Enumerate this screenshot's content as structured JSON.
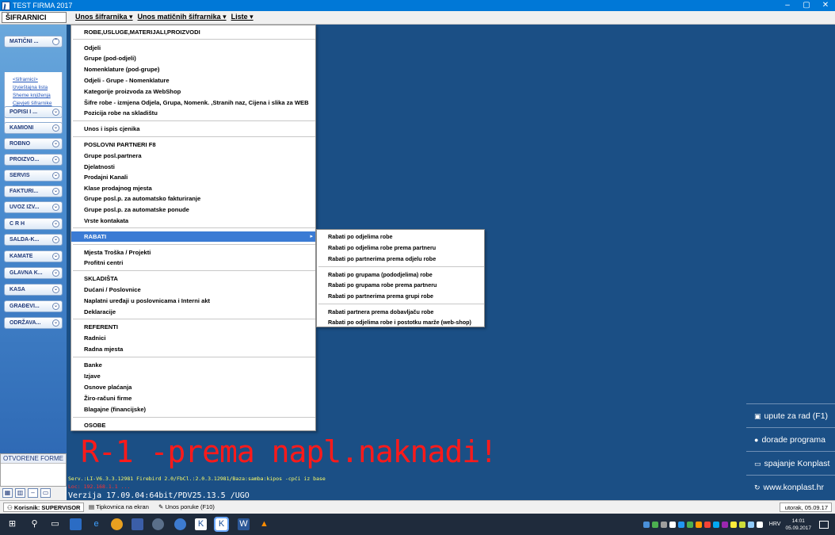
{
  "window": {
    "title": "TEST FIRMA  2017",
    "controls": [
      "–",
      "▢",
      "✕"
    ]
  },
  "menubar": {
    "module_label": "ŠIFRARNICI",
    "items": [
      {
        "label": "Unos šifrarnika ▾"
      },
      {
        "label": "Unos matičnih šifrarnika ▾"
      },
      {
        "label": "Liste ▾"
      }
    ]
  },
  "sidebar": {
    "buttons": [
      {
        "label": "MATIČNI ..."
      },
      {
        "label": "POPISI I ..."
      },
      {
        "label": "KAMIONI"
      },
      {
        "label": "ROBNO"
      },
      {
        "label": "PROIZVO..."
      },
      {
        "label": "SERVIS"
      },
      {
        "label": "FAKTURI..."
      },
      {
        "label": "UVOZ IZV..."
      },
      {
        "label": "C R H"
      },
      {
        "label": "SALDA-K..."
      },
      {
        "label": "KAMATE"
      },
      {
        "label": "GLAVNA K..."
      },
      {
        "label": "KASA"
      },
      {
        "label": "GRAĐEVI..."
      },
      {
        "label": "ODRŽAVA..."
      }
    ],
    "expanded_links": [
      "<šifrarnici>",
      "Izvještajna lista",
      "Sheme knjiženja",
      "Cjevjeti šifrarnike"
    ],
    "open_forms_label": "OTVORENE FORME"
  },
  "dropdown": {
    "items": [
      {
        "label": "ROBE,USLUGE,MATERIJALI,PROIZVODI"
      },
      {
        "label": "Odjeli"
      },
      {
        "label": "Grupe (pod-odjeli)"
      },
      {
        "label": "Nomenklature (pod-grupe)"
      },
      {
        "label": "Odjeli - Grupe - Nomenklature"
      },
      {
        "label": "Kategorije proizvoda za WebShop"
      },
      {
        "label": "Šifre robe - izmjena Odjela, Grupa, Nomenk. ,Stranih naz, Cijena i slika za WEB"
      },
      {
        "label": "Pozicija robe na skladištu"
      },
      {
        "label": "Unos i ispis cjenika"
      },
      {
        "label": "POSLOVNI PARTNERI     F8"
      },
      {
        "label": "Grupe posl.partnera"
      },
      {
        "label": "Djelatnosti"
      },
      {
        "label": "Prodajni Kanali"
      },
      {
        "label": "Klase prodajnog mjesta"
      },
      {
        "label": "Grupe posl.p. za automatsko fakturiranje"
      },
      {
        "label": "Grupe posl.p. za automatske ponude"
      },
      {
        "label": "Vrste kontakata"
      },
      {
        "label": "RABATI"
      },
      {
        "label": "Mjesta Troška / Projekti"
      },
      {
        "label": "Profitni centri"
      },
      {
        "label": "SKLADIŠTA"
      },
      {
        "label": "Dućani / Poslovnice"
      },
      {
        "label": "Naplatni uređaji u poslovnicama i Interni akt"
      },
      {
        "label": "Deklaracije"
      },
      {
        "label": "REFERENTI"
      },
      {
        "label": "Radnici"
      },
      {
        "label": "Radna mjesta"
      },
      {
        "label": "Banke"
      },
      {
        "label": "Izjave"
      },
      {
        "label": "Osnove plaćanja"
      },
      {
        "label": "Žiro-računi firme"
      },
      {
        "label": "Blagajne (financijske)"
      },
      {
        "label": "OSOBE"
      }
    ],
    "submenu_arrow": "▸"
  },
  "submenu": {
    "items": [
      {
        "label": "Rabati po odjelima robe"
      },
      {
        "label": "Rabati po odjelima robe prema partneru"
      },
      {
        "label": "Rabati po partnerima prema odjelu robe"
      },
      {
        "label": "Rabati po grupama (pododjelima) robe"
      },
      {
        "label": "Rabati po grupama robe prema partneru"
      },
      {
        "label": "Rabati po partnerima prema grupi robe"
      },
      {
        "label": "Rabati partnera prema dobavljaču robe"
      },
      {
        "label": "Rabati po odjelima robe i postotku marže (web-shop)"
      }
    ]
  },
  "workspace": {
    "big_message": "R-1 -prema napl.naknadi!",
    "server_line": "Serv.:LI-V6.3.3.12981 Firebird 2.0/FbCl.:2.0.3.12981/Baza:samba:kipos -cpći iz base",
    "server_line2": "Loc: 192.168.1.1 ...",
    "version": "Verzija 17.09.04:64bit/PDV25.13.5 /UGO",
    "links": [
      {
        "icon": "book-icon",
        "glyph": "▣",
        "label": "upute za rad (F1)"
      },
      {
        "icon": "info-icon",
        "glyph": "●",
        "label": "dorade programa"
      },
      {
        "icon": "monitor-icon",
        "glyph": "▭",
        "label": "spajanje Konplast"
      },
      {
        "icon": "refresh-icon",
        "glyph": "↻",
        "label": "www.konplast.hr"
      }
    ]
  },
  "statusbar": {
    "user": "Korisnik: SUPERVISOR",
    "tipkovnica": "Tipkovnica na ekran",
    "unos_poruke": "Unos poruke (F10)",
    "date": "utorak, 05.09.17"
  },
  "taskbar": {
    "lang": "HRV",
    "time": "14:01",
    "date": "05.09.2017"
  },
  "colors": {
    "workspace_bg": "#1b4f85",
    "menu_highlight": "#3b7bd4",
    "big_message": "#ff1a1a",
    "titlebar": "#0078d7"
  }
}
